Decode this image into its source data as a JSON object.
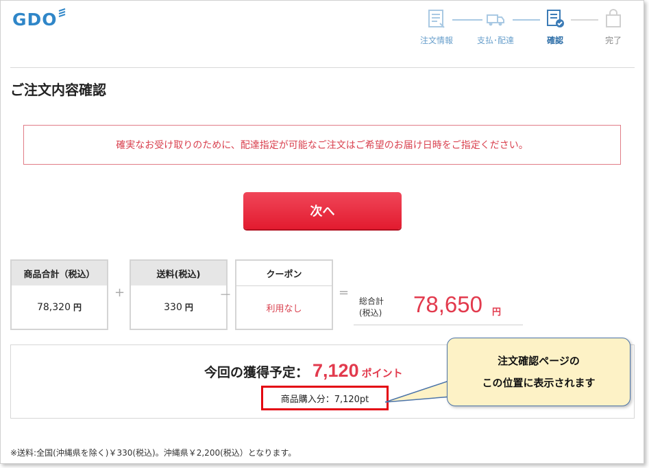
{
  "header": {
    "logo_text": "GDO",
    "steps": [
      {
        "label": "注文情報",
        "state": "done"
      },
      {
        "label": "支払･配達",
        "state": "done"
      },
      {
        "label": "確認",
        "state": "active"
      },
      {
        "label": "完了",
        "state": "todo"
      }
    ]
  },
  "page_title": "ご注文内容確認",
  "notice": "確実なお受け取りのために、配達指定が可能なご注文はご希望のお届け日時をご指定ください。",
  "next_button": "次へ",
  "summary": {
    "subtotal": {
      "label": "商品合計（税込）",
      "value": "78,320",
      "unit": "円"
    },
    "plus": "+",
    "shipping": {
      "label": "送料(税込)",
      "value": "330",
      "unit": "円"
    },
    "minus": "－",
    "coupon": {
      "label": "クーポン",
      "value": "利用なし"
    },
    "equals": "=",
    "total": {
      "label_line1": "総合計",
      "label_line2": "(税込)",
      "value": "78,650",
      "unit": "円"
    }
  },
  "points": {
    "lead": "今回の獲得予定：",
    "value": "7,120",
    "unit": "ポイント",
    "detail": "商品購入分：7,120pt"
  },
  "callout": {
    "line1": "注文確認ページの",
    "line2": "この位置に表示されます"
  },
  "footnote": "※送料:全国(沖縄県を除く)￥330(税込)。沖縄県￥2,200(税込）となります。",
  "colors": {
    "brand": "#2f86c8",
    "accent_red": "#e23a4d",
    "callout_bg": "#fdf2c6",
    "highlight": "#e3000f"
  }
}
